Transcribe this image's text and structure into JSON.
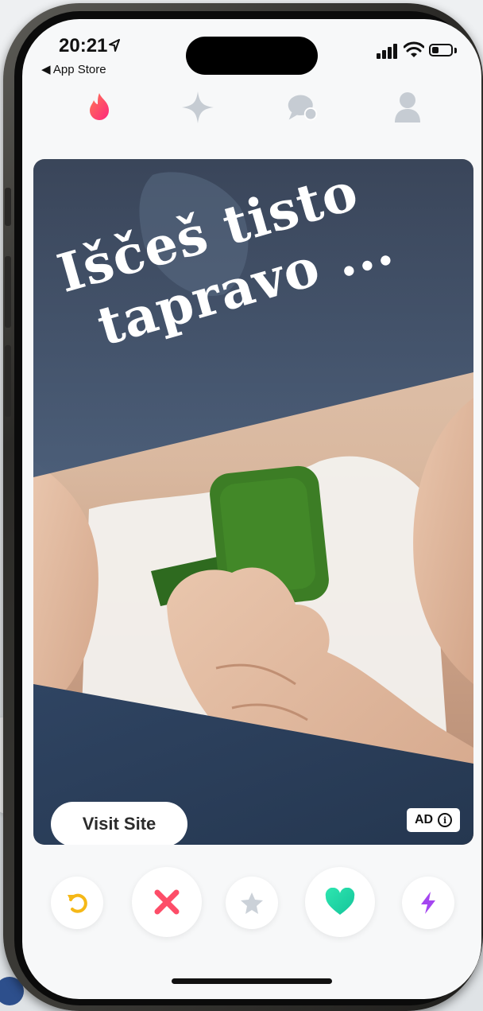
{
  "status_bar": {
    "time": "20:21",
    "location_arrow": "◁",
    "back_label": "◀ App Store"
  },
  "nav": {
    "items": [
      {
        "name": "flame-icon",
        "active": true
      },
      {
        "name": "sparkle-icon",
        "active": false
      },
      {
        "name": "chat-bubbles-icon",
        "active": false
      },
      {
        "name": "profile-icon",
        "active": false
      }
    ]
  },
  "ad": {
    "headline_line1": "Iščeš tisto",
    "headline_line2": "tapravo ...",
    "cta_label": "Visit Site",
    "badge_label": "AD",
    "info_glyph": "i"
  },
  "actions": [
    {
      "name": "rewind-icon",
      "color": "#f5b817"
    },
    {
      "name": "nope-icon",
      "color": "#fd4d68"
    },
    {
      "name": "super-like-star-icon",
      "color": "#cbd1d8"
    },
    {
      "name": "like-heart-icon",
      "color": "#22d3a6"
    },
    {
      "name": "boost-bolt-icon",
      "color": "#a445f0"
    }
  ],
  "colors": {
    "brand_flame": "#fe3c72",
    "nav_inactive": "#c6ccd3",
    "card_overlay": "#2f4462"
  }
}
